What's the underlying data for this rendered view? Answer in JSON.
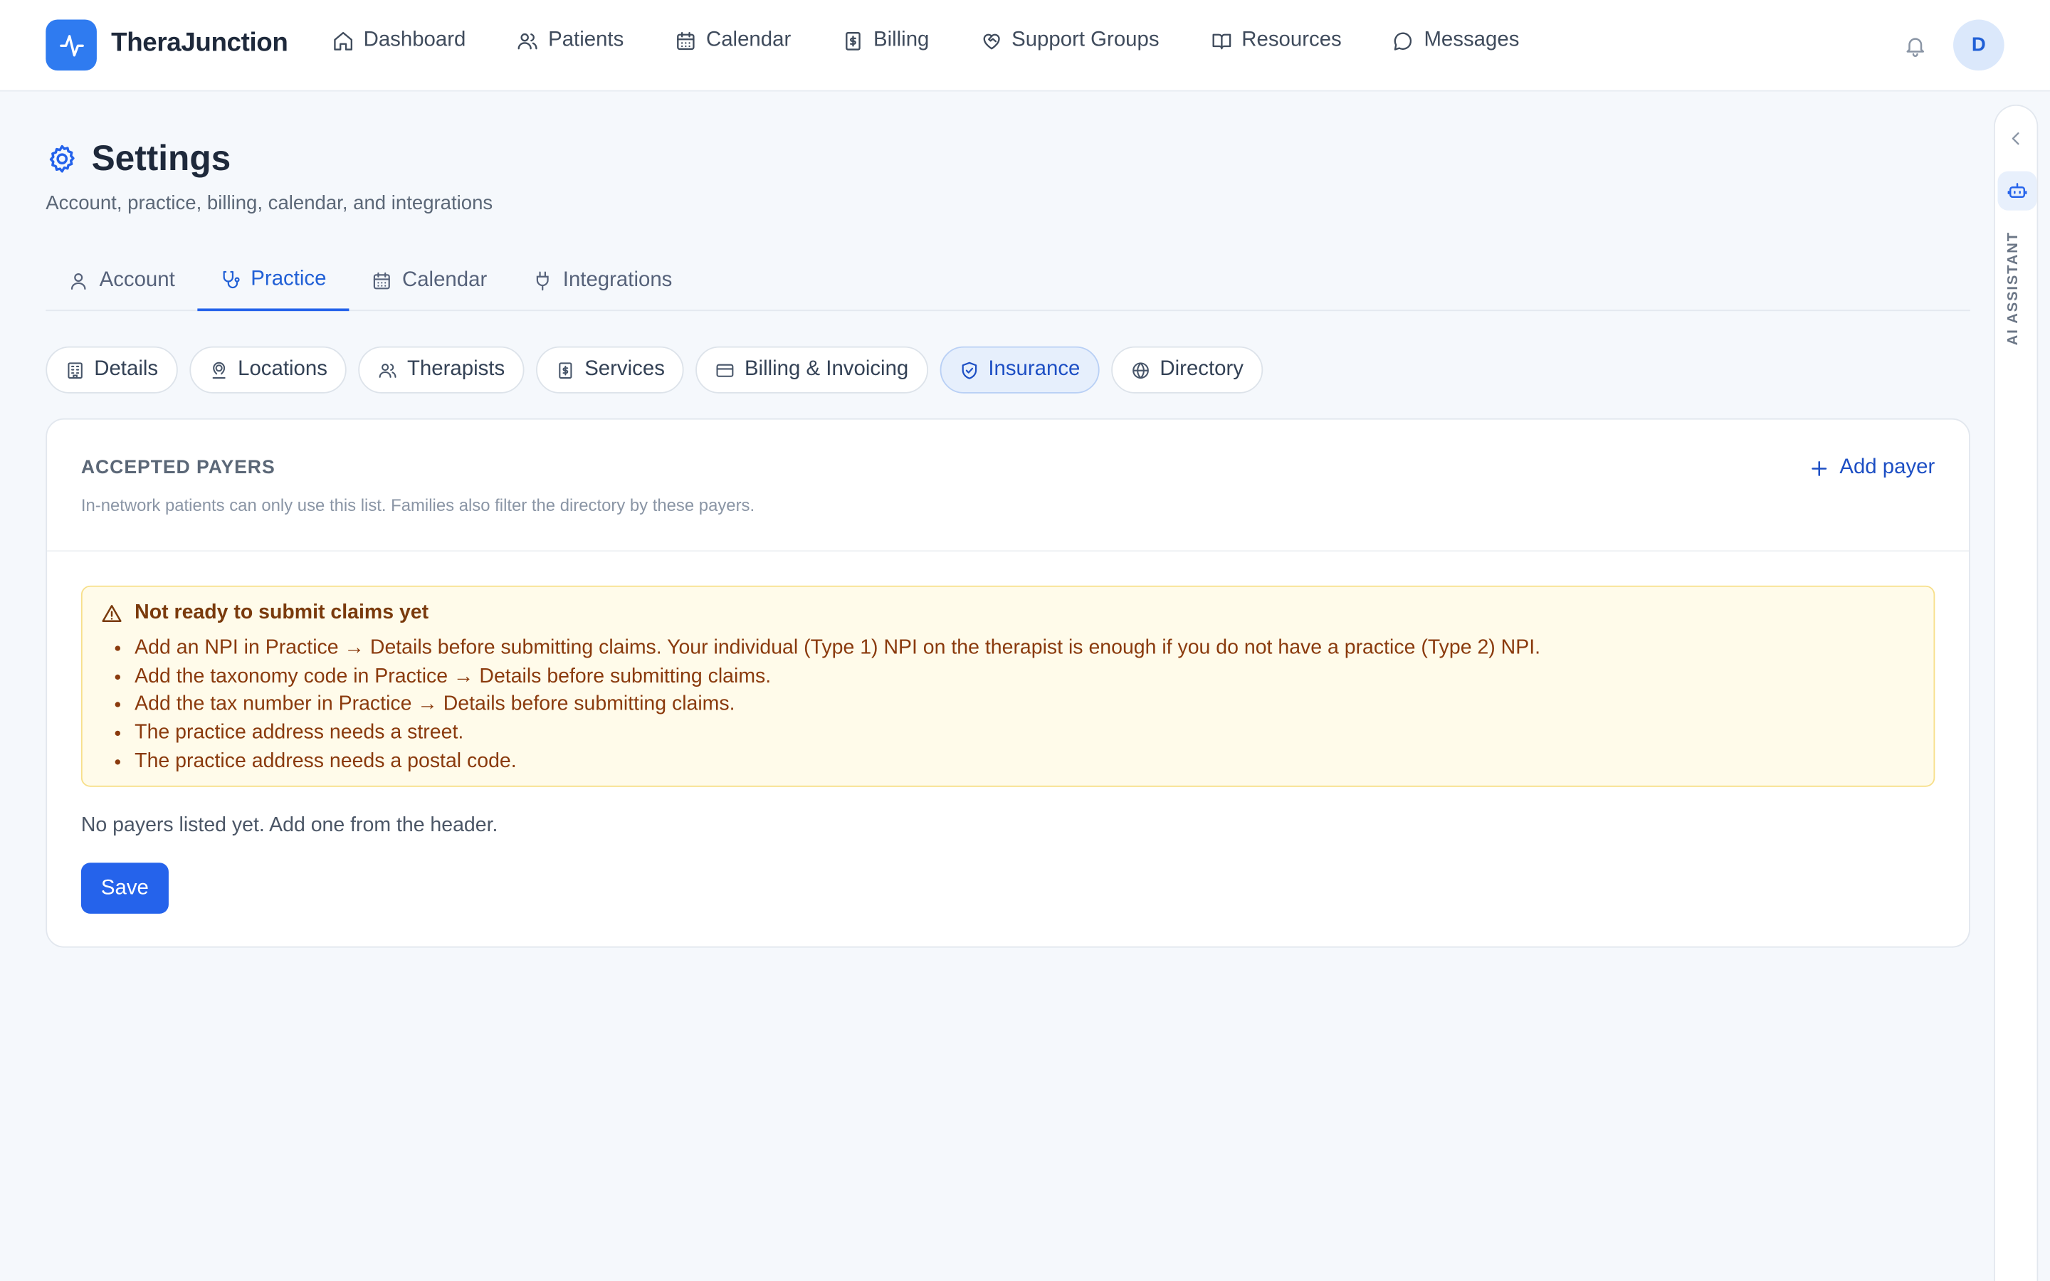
{
  "brand": {
    "name": "TheraJunction",
    "accent": "#2f7bf0"
  },
  "nav": {
    "items": [
      {
        "label": "Dashboard",
        "icon": "home-icon"
      },
      {
        "label": "Patients",
        "icon": "users-icon"
      },
      {
        "label": "Calendar",
        "icon": "calendar-icon"
      },
      {
        "label": "Billing",
        "icon": "receipt-icon"
      },
      {
        "label": "Support Groups",
        "icon": "heart-handshake-icon"
      },
      {
        "label": "Resources",
        "icon": "book-open-icon"
      },
      {
        "label": "Messages",
        "icon": "message-circle-icon"
      }
    ],
    "avatar_initial": "D"
  },
  "header": {
    "title": "Settings",
    "subtitle": "Account, practice, billing, calendar, and integrations"
  },
  "tabs": [
    {
      "label": "Account",
      "icon": "user-icon",
      "active": false
    },
    {
      "label": "Practice",
      "icon": "stethoscope-icon",
      "active": true
    },
    {
      "label": "Calendar",
      "icon": "calendar-icon",
      "active": false
    },
    {
      "label": "Integrations",
      "icon": "plug-icon",
      "active": false
    }
  ],
  "subtabs": [
    {
      "label": "Details",
      "icon": "building-icon",
      "active": false
    },
    {
      "label": "Locations",
      "icon": "map-pin-user-icon",
      "active": false
    },
    {
      "label": "Therapists",
      "icon": "users-icon",
      "active": false
    },
    {
      "label": "Services",
      "icon": "receipt-icon",
      "active": false
    },
    {
      "label": "Billing & Invoicing",
      "icon": "credit-card-icon",
      "active": false
    },
    {
      "label": "Insurance",
      "icon": "shield-check-icon",
      "active": true
    },
    {
      "label": "Directory",
      "icon": "globe-icon",
      "active": false
    }
  ],
  "card": {
    "title": "ACCEPTED PAYERS",
    "description": "In-network patients can only use this list. Families also filter the directory by these payers.",
    "add_label": "Add payer",
    "alert": {
      "title": "Not ready to submit claims yet",
      "items": [
        "Add an NPI in Practice → Details before submitting claims. Your individual (Type 1) NPI on the therapist is enough if you do not have a practice (Type 2) NPI.",
        "Add the taxonomy code in Practice → Details before submitting claims.",
        "Add the tax number in Practice → Details before submitting claims.",
        "The practice address needs a street.",
        "The practice address needs a postal code."
      ]
    },
    "empty_message": "No payers listed yet. Add one from the header.",
    "save_label": "Save"
  },
  "assistant": {
    "label": "AI ASSISTANT"
  }
}
